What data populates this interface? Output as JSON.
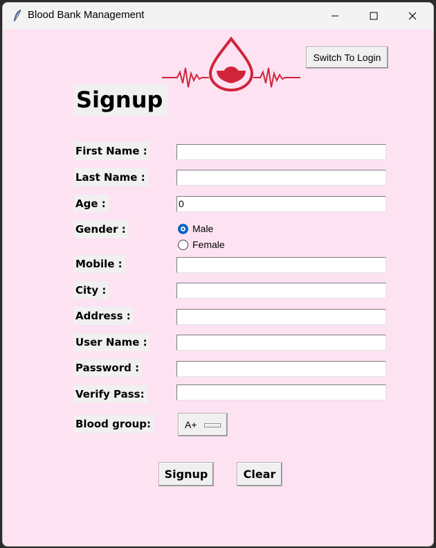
{
  "window": {
    "title": "Blood Bank Management",
    "icon": "feather-icon"
  },
  "header": {
    "switch_label": "Switch To Login",
    "heading": "Signup",
    "logo": "blood-drop-heartbeat-logo"
  },
  "form": {
    "first_name": {
      "label": "First Name :",
      "value": ""
    },
    "last_name": {
      "label": "Last Name :",
      "value": ""
    },
    "age": {
      "label": "Age :",
      "value": "0"
    },
    "gender": {
      "label": "Gender :",
      "options": [
        "Male",
        "Female"
      ],
      "selected": "Male"
    },
    "mobile": {
      "label": "Mobile :",
      "value": ""
    },
    "city": {
      "label": "City :",
      "value": ""
    },
    "address": {
      "label": "Address :",
      "value": ""
    },
    "username": {
      "label": "User Name :",
      "value": ""
    },
    "password": {
      "label": "Password :",
      "value": ""
    },
    "verify": {
      "label": "Verify Pass:",
      "value": ""
    },
    "blood_group": {
      "label": "Blood group:",
      "value": "A+"
    }
  },
  "actions": {
    "signup_label": "Signup",
    "clear_label": "Clear"
  },
  "colors": {
    "background": "#fde2f2",
    "logo_red": "#d0243a",
    "radio_blue": "#0a64c8"
  }
}
